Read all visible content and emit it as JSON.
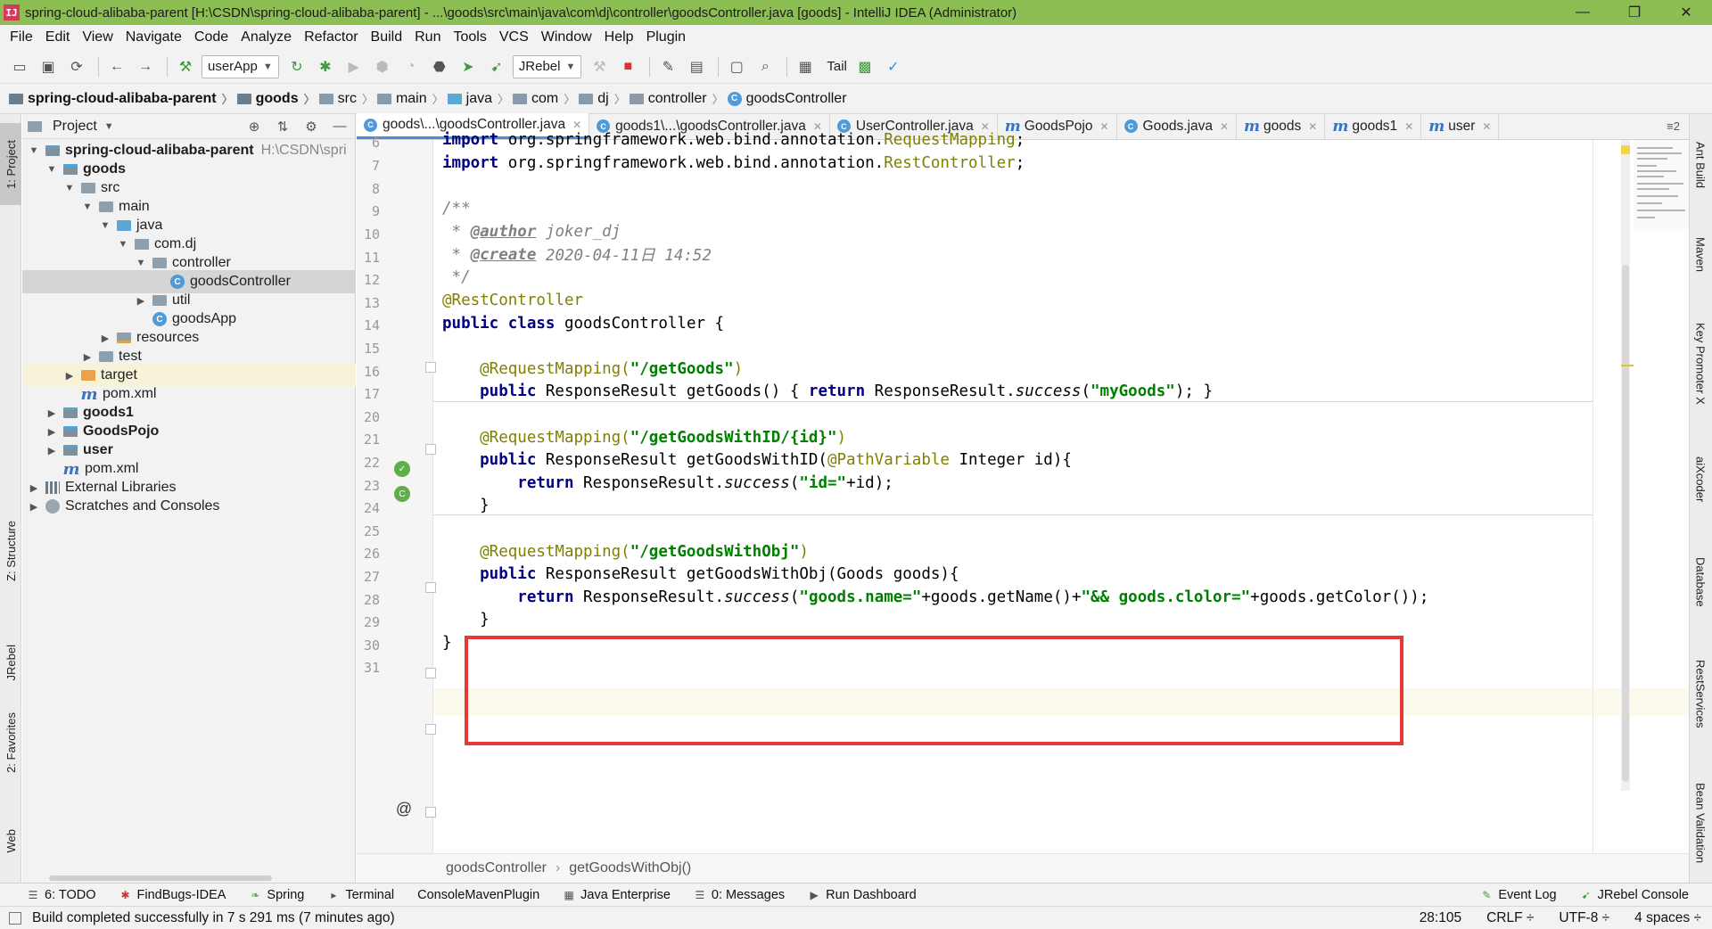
{
  "window": {
    "title": "spring-cloud-alibaba-parent [H:\\CSDN\\spring-cloud-alibaba-parent] - ...\\goods\\src\\main\\java\\com\\dj\\controller\\goodsController.java [goods] - IntelliJ IDEA (Administrator)",
    "app_icon_text": "IJ",
    "minimize": "—",
    "maximize": "❐",
    "close": "✕"
  },
  "menu": [
    "File",
    "Edit",
    "View",
    "Navigate",
    "Code",
    "Analyze",
    "Refactor",
    "Build",
    "Run",
    "Tools",
    "VCS",
    "Window",
    "Help",
    "Plugin"
  ],
  "toolbar": {
    "run_config": "userApp",
    "jrebel_label": "JRebel",
    "tail_label": "Tail"
  },
  "breadcrumb": [
    "spring-cloud-alibaba-parent",
    "goods",
    "src",
    "main",
    "java",
    "com",
    "dj",
    "controller",
    "goodsController"
  ],
  "project_panel": {
    "title": "Project",
    "tree": [
      {
        "label": "spring-cloud-alibaba-parent",
        "path": "H:\\CSDN\\spri",
        "bold": true
      },
      {
        "label": "goods",
        "bold": true
      },
      {
        "label": "src"
      },
      {
        "label": "main"
      },
      {
        "label": "java"
      },
      {
        "label": "com.dj"
      },
      {
        "label": "controller"
      },
      {
        "label": "goodsController"
      },
      {
        "label": "util"
      },
      {
        "label": "goodsApp"
      },
      {
        "label": "resources"
      },
      {
        "label": "test"
      },
      {
        "label": "target"
      },
      {
        "label": "pom.xml"
      },
      {
        "label": "goods1",
        "bold": true
      },
      {
        "label": "GoodsPojo",
        "bold": true
      },
      {
        "label": "user",
        "bold": true
      },
      {
        "label": "pom.xml"
      },
      {
        "label": "External Libraries"
      },
      {
        "label": "Scratches and Consoles"
      }
    ]
  },
  "left_stripe": {
    "project": "1: Project",
    "structure": "Z: Structure",
    "jrebel": "JRebel",
    "favorites": "2: Favorites",
    "web": "Web"
  },
  "right_stripe": {
    "ant": "Ant Build",
    "maven": "Maven",
    "key_promoter": "Key Promoter X",
    "aixcoder": "aiXcoder",
    "database": "Database",
    "rest": "RestServices",
    "bean": "Bean Validation"
  },
  "tabs": [
    {
      "label": "goods\\...\\goodsController.java",
      "type": "class",
      "active": true
    },
    {
      "label": "goods1\\...\\goodsController.java",
      "type": "class"
    },
    {
      "label": "UserController.java",
      "type": "class"
    },
    {
      "label": "GoodsPojo",
      "type": "maven"
    },
    {
      "label": "Goods.java",
      "type": "class"
    },
    {
      "label": "goods",
      "type": "maven"
    },
    {
      "label": "goods1",
      "type": "maven"
    },
    {
      "label": "user",
      "type": "maven"
    }
  ],
  "tabs_overflow": "≡2",
  "editor": {
    "line_numbers": [
      "6",
      "7",
      "8",
      "9",
      "10",
      "11",
      "12",
      "13",
      "14",
      "15",
      "16",
      "17",
      "20",
      "21",
      "22",
      "23",
      "24",
      "25",
      "26",
      "27",
      "28",
      "29",
      "30",
      "31"
    ],
    "code": {
      "l6_kw": "import",
      "l6_rest": " org.springframework.web.bind.annotation.",
      "l6_anno": "RequestMapping",
      "l6_end": ";",
      "l7_kw": "import",
      "l7_rest": " org.springframework.web.bind.annotation.",
      "l7_anno": "RestController",
      "l7_end": ";",
      "l9": "/**",
      "l10_star": " * ",
      "l10_tag": "@author",
      "l10_val": " joker_dj",
      "l11_star": " * ",
      "l11_tag": "@create",
      "l11_val": " 2020-04-11日 14:52",
      "l12": " */",
      "l13": "@RestController",
      "l14_kw1": "public class",
      "l14_rest": " goodsController {",
      "l16_anno": "    @RequestMapping(",
      "l16_str": "\"/getGoods\"",
      "l16_end": ")",
      "l17_kw": "    public",
      "l17_mid": " ResponseResult getGoods() { ",
      "l17_kw2": "return",
      "l17_mid2": " ResponseResult.",
      "l17_it": "success",
      "l17_p": "(",
      "l17_str": "\"myGoods\"",
      "l17_end": "); }",
      "l21_anno": "    @RequestMapping(",
      "l21_str": "\"/getGoodsWithID/{id}\"",
      "l21_end": ")",
      "l22_kw": "    public",
      "l22_mid": " ResponseResult getGoodsWithID(",
      "l22_anno": "@PathVariable",
      "l22_end": " Integer id){",
      "l23_kw": "        return",
      "l23_mid": " ResponseResult.",
      "l23_it": "success",
      "l23_p": "(",
      "l23_str": "\"id=\"",
      "l23_end": "+id);",
      "l24": "    }",
      "l26_anno": "    @RequestMapping(",
      "l26_str": "\"/getGoodsWithObj\"",
      "l26_end": ")",
      "l27_kw": "    public",
      "l27_mid": " ResponseResult getGoodsWithObj(Goods goods){",
      "l28_kw": "        return",
      "l28_mid": " ResponseResult.",
      "l28_it": "success",
      "l28_p": "(",
      "l28_str1": "\"goods.name=\"",
      "l28_mid2": "+goods.getName()+",
      "l28_str2": "\"&& goods.clolor=\"",
      "l28_mid3": "+goods.getColor())",
      "l28_end": ";",
      "l29": "    }",
      "l30": "}"
    }
  },
  "editor_breadcrumb": [
    "goodsController",
    "getGoodsWithObj()"
  ],
  "bottom_tools": {
    "left": [
      "6: TODO",
      "FindBugs-IDEA",
      "Spring",
      "Terminal",
      "ConsoleMavenPlugin",
      "Java Enterprise",
      "0: Messages",
      "Run Dashboard"
    ],
    "right": [
      "Event Log",
      "JRebel Console"
    ]
  },
  "status": {
    "message": "Build completed successfully in 7 s 291 ms (7 minutes ago)",
    "position": "28:105",
    "line_sep": "CRLF ÷",
    "encoding": "UTF-8 ÷",
    "indent": "4 spaces ÷"
  },
  "colors": {
    "titlebar": "#8cbe54",
    "highlight_box": "#e53935",
    "keyword": "#000080",
    "annotation": "#808000",
    "string": "#008000"
  }
}
